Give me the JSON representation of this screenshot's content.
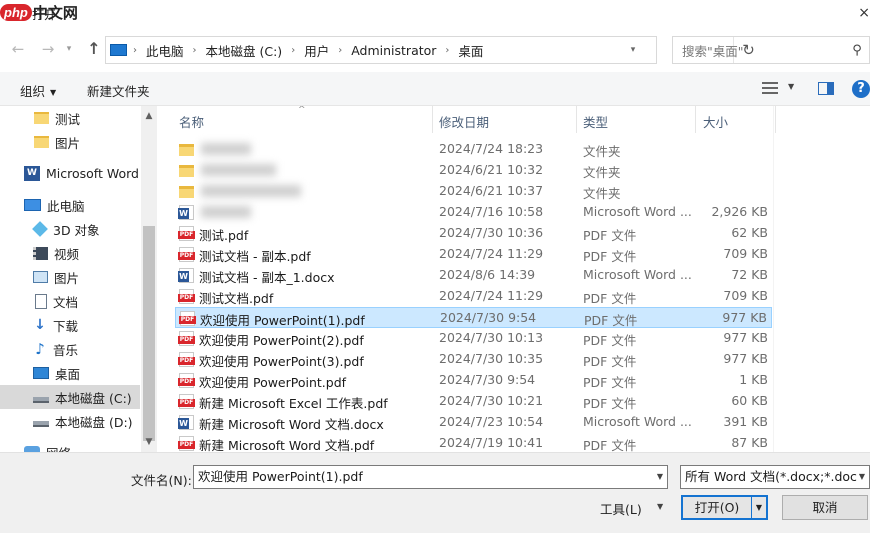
{
  "watermark": {
    "logo": "php",
    "text": "中文网"
  },
  "window": {
    "title": "打开",
    "close": "×"
  },
  "address": {
    "breadcrumb": [
      "此电脑",
      "本地磁盘 (C:)",
      "用户",
      "Administrator",
      "桌面"
    ],
    "separator": "›",
    "refresh": "↻"
  },
  "search": {
    "placeholder": "搜索\"桌面\""
  },
  "toolbar": {
    "organize": "组织",
    "new_folder": "新建文件夹",
    "help": "?"
  },
  "nav": {
    "items": [
      {
        "label": "测试",
        "icon": "folder-icon"
      },
      {
        "label": "图片",
        "icon": "folder-icon"
      },
      {
        "label": "Microsoft Word",
        "icon": "word-icon"
      },
      {
        "label": "此电脑",
        "icon": "computer-icon"
      },
      {
        "label": "3D 对象",
        "icon": "3d-objects-icon"
      },
      {
        "label": "视频",
        "icon": "video-icon"
      },
      {
        "label": "图片",
        "icon": "pictures-icon"
      },
      {
        "label": "文档",
        "icon": "documents-icon"
      },
      {
        "label": "下载",
        "icon": "download-icon"
      },
      {
        "label": "音乐",
        "icon": "music-icon"
      },
      {
        "label": "桌面",
        "icon": "desktop-icon"
      },
      {
        "label": "本地磁盘 (C:)",
        "icon": "drive-icon"
      },
      {
        "label": "本地磁盘 (D:)",
        "icon": "drive-icon"
      },
      {
        "label": "网络",
        "icon": "network-icon"
      }
    ],
    "selected": "本地磁盘 (C:)"
  },
  "columns": {
    "name": "名称",
    "modified": "修改日期",
    "type": "类型",
    "size": "大小"
  },
  "files": [
    {
      "name": "",
      "date": "2024/7/24 18:23",
      "type": "文件夹",
      "size": "",
      "kind": "folder",
      "blurred": true
    },
    {
      "name": "",
      "date": "2024/6/21 10:32",
      "type": "文件夹",
      "size": "",
      "kind": "folder",
      "blurred": true
    },
    {
      "name": "",
      "date": "2024/6/21 10:37",
      "type": "文件夹",
      "size": "",
      "kind": "folder",
      "blurred": true
    },
    {
      "name": "",
      "date": "2024/7/16 10:58",
      "type": "Microsoft Word ...",
      "size": "2,926 KB",
      "kind": "word",
      "blurred": true
    },
    {
      "name": "测试.pdf",
      "date": "2024/7/30 10:36",
      "type": "PDF 文件",
      "size": "62 KB",
      "kind": "pdf"
    },
    {
      "name": "测试文档 - 副本.pdf",
      "date": "2024/7/24 11:29",
      "type": "PDF 文件",
      "size": "709 KB",
      "kind": "pdf"
    },
    {
      "name": "测试文档 - 副本_1.docx",
      "date": "2024/8/6 14:39",
      "type": "Microsoft Word ...",
      "size": "72 KB",
      "kind": "word"
    },
    {
      "name": "测试文档.pdf",
      "date": "2024/7/24 11:29",
      "type": "PDF 文件",
      "size": "709 KB",
      "kind": "pdf"
    },
    {
      "name": "欢迎使用 PowerPoint(1).pdf",
      "date": "2024/7/30 9:54",
      "type": "PDF 文件",
      "size": "977 KB",
      "kind": "pdf",
      "selected": true
    },
    {
      "name": "欢迎使用 PowerPoint(2).pdf",
      "date": "2024/7/30 10:13",
      "type": "PDF 文件",
      "size": "977 KB",
      "kind": "pdf"
    },
    {
      "name": "欢迎使用 PowerPoint(3).pdf",
      "date": "2024/7/30 10:35",
      "type": "PDF 文件",
      "size": "977 KB",
      "kind": "pdf"
    },
    {
      "name": "欢迎使用 PowerPoint.pdf",
      "date": "2024/7/30 9:54",
      "type": "PDF 文件",
      "size": "1 KB",
      "kind": "pdf"
    },
    {
      "name": "新建 Microsoft Excel 工作表.pdf",
      "date": "2024/7/30 10:21",
      "type": "PDF 文件",
      "size": "60 KB",
      "kind": "pdf"
    },
    {
      "name": "新建 Microsoft Word 文档.docx",
      "date": "2024/7/23 10:54",
      "type": "Microsoft Word ...",
      "size": "391 KB",
      "kind": "word"
    },
    {
      "name": "新建 Microsoft Word 文档.pdf",
      "date": "2024/7/19 10:41",
      "type": "PDF 文件",
      "size": "87 KB",
      "kind": "pdf"
    }
  ],
  "bottom": {
    "filename_label": "文件名(N):",
    "filename_value": "欢迎使用 PowerPoint(1).pdf",
    "filter_value": "所有 Word 文档(*.docx;*.docx",
    "tools": "工具(L)",
    "open": "打开(O)",
    "cancel": "取消"
  },
  "colors": {
    "selection": "#cce8ff",
    "selection_border": "#99d1ff",
    "accent": "#1473d1"
  }
}
